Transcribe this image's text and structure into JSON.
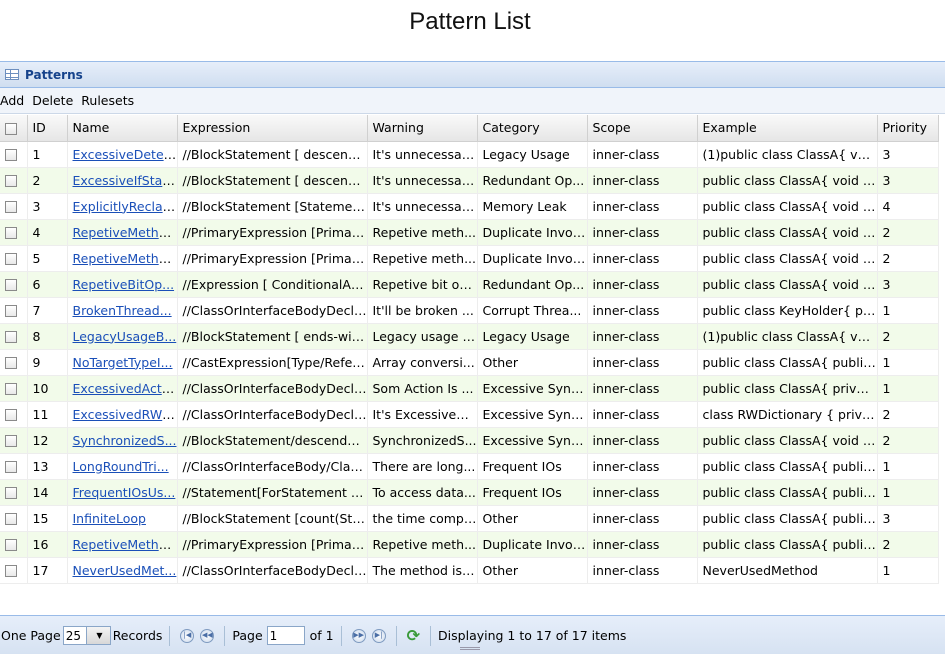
{
  "page": {
    "title": "Pattern List"
  },
  "panel": {
    "title": "Patterns"
  },
  "toolbar": {
    "add": "Add",
    "delete": "Delete",
    "rulesets": "Rulesets"
  },
  "columns": [
    "ID",
    "Name",
    "Expression",
    "Warning",
    "Category",
    "Scope",
    "Example",
    "Priority"
  ],
  "rows": [
    {
      "id": "1",
      "name": "ExcessiveDetec...",
      "expr": "//BlockStatement [ descenda...",
      "warning": "It's unnecessar...",
      "category": "Legacy Usage",
      "scope": "inner-class",
      "example": "(1)public class ClassA{ void...",
      "priority": "3"
    },
    {
      "id": "2",
      "name": "ExcessiveIfStat...",
      "expr": "//BlockStatement [ descenda...",
      "warning": "It's unnecessar...",
      "category": "Redundant Op...",
      "scope": "inner-class",
      "example": "public class ClassA{ void m...",
      "priority": "3"
    },
    {
      "id": "3",
      "name": "ExplicitlyReclai...",
      "expr": "//BlockStatement [Statement...",
      "warning": "It's unnecessar...",
      "category": "Memory Leak",
      "scope": "inner-class",
      "example": "public class ClassA{ void m...",
      "priority": "4"
    },
    {
      "id": "4",
      "name": "RepetiveMetho...",
      "expr": "//PrimaryExpression [Primary...",
      "warning": "Repetive meth...",
      "category": "Duplicate Invoc...",
      "scope": "inner-class",
      "example": "public class ClassA{ void m...",
      "priority": "2"
    },
    {
      "id": "5",
      "name": "RepetiveMetho...",
      "expr": "//PrimaryExpression [Primary...",
      "warning": "Repetive meth...",
      "category": "Duplicate Invoc...",
      "scope": "inner-class",
      "example": "public class ClassA{ void m...",
      "priority": "2"
    },
    {
      "id": "6",
      "name": "RepetiveBitOp...",
      "expr": "//Expression [ ConditionalAn...",
      "warning": "Repetive bit op...",
      "category": "Redundant Op...",
      "scope": "inner-class",
      "example": "public class ClassA{ void m...",
      "priority": "3"
    },
    {
      "id": "7",
      "name": "BrokenThread...",
      "expr": "//ClassOrInterfaceBodyDecla...",
      "warning": "It'll be broken ...",
      "category": "Corrupt Threa...",
      "scope": "inner-class",
      "example": "public class KeyHolder{ pri...",
      "priority": "1"
    },
    {
      "id": "8",
      "name": "LegacyUsageB...",
      "expr": "//BlockStatement [ ends-with...",
      "warning": "Legacy usage c...",
      "category": "Legacy Usage",
      "scope": "inner-class",
      "example": "(1)public class ClassA{ void...",
      "priority": "2"
    },
    {
      "id": "9",
      "name": "NoTargetTypeI...",
      "expr": "//CastExpression[Type/Refer...",
      "warning": "Array conversi...",
      "category": "Other",
      "scope": "inner-class",
      "example": "public class ClassA{ public ...",
      "priority": "1"
    },
    {
      "id": "10",
      "name": "ExcessivedActi...",
      "expr": "//ClassOrInterfaceBodyDecla...",
      "warning": "Som Action Is ...",
      "category": "Excessive Sync...",
      "scope": "inner-class",
      "example": "public class ClassA{ private...",
      "priority": "1"
    },
    {
      "id": "11",
      "name": "ExcessivedRWL...",
      "expr": "//ClassOrInterfaceBodyDecla...",
      "warning": "It's Excessived ...",
      "category": "Excessive Sync...",
      "scope": "inner-class",
      "example": "class RWDictionary { privat...",
      "priority": "2"
    },
    {
      "id": "12",
      "name": "SynchronizedS...",
      "expr": "//BlockStatement/descendan...",
      "warning": "SynchronizedS...",
      "category": "Excessive Sync...",
      "scope": "inner-class",
      "example": "public class ClassA{ void m...",
      "priority": "2"
    },
    {
      "id": "13",
      "name": "LongRoundTri...",
      "expr": "//ClassOrInterfaceBody/Clas...",
      "warning": "There are long...",
      "category": "Frequent IOs",
      "scope": "inner-class",
      "example": "public class ClassA{ public ...",
      "priority": "1"
    },
    {
      "id": "14",
      "name": "FrequentIOsUs...",
      "expr": "//Statement[ForStatement or...",
      "warning": "To access data...",
      "category": "Frequent IOs",
      "scope": "inner-class",
      "example": "public class ClassA{ public ...",
      "priority": "1"
    },
    {
      "id": "15",
      "name": "InfiniteLoop",
      "expr": "//BlockStatement [count(Stat...",
      "warning": "the time compl...",
      "category": "Other",
      "scope": "inner-class",
      "example": "public class ClassA{ public ...",
      "priority": "3"
    },
    {
      "id": "16",
      "name": "RepetiveMetho...",
      "expr": "//PrimaryExpression [Primary...",
      "warning": "Repetive meth...",
      "category": "Duplicate Invoc...",
      "scope": "inner-class",
      "example": "public class ClassA{ public ...",
      "priority": "2"
    },
    {
      "id": "17",
      "name": "NeverUsedMet...",
      "expr": "//ClassOrInterfaceBodyDecla...",
      "warning": "The method is ...",
      "category": "Other",
      "scope": "inner-class",
      "example": "NeverUsedMethod",
      "priority": "1"
    }
  ],
  "pager": {
    "one_page": "One Page",
    "page_size": "25",
    "records": "Records",
    "page_label": "Page",
    "page_value": "1",
    "of_label": "of 1",
    "display": "Displaying 1 to 17 of 17 items"
  },
  "icons": {
    "first": "first-page-icon",
    "prev": "prev-page-icon",
    "next": "next-page-icon",
    "last": "last-page-icon",
    "refresh": "refresh-icon",
    "grid": "grid-icon"
  }
}
